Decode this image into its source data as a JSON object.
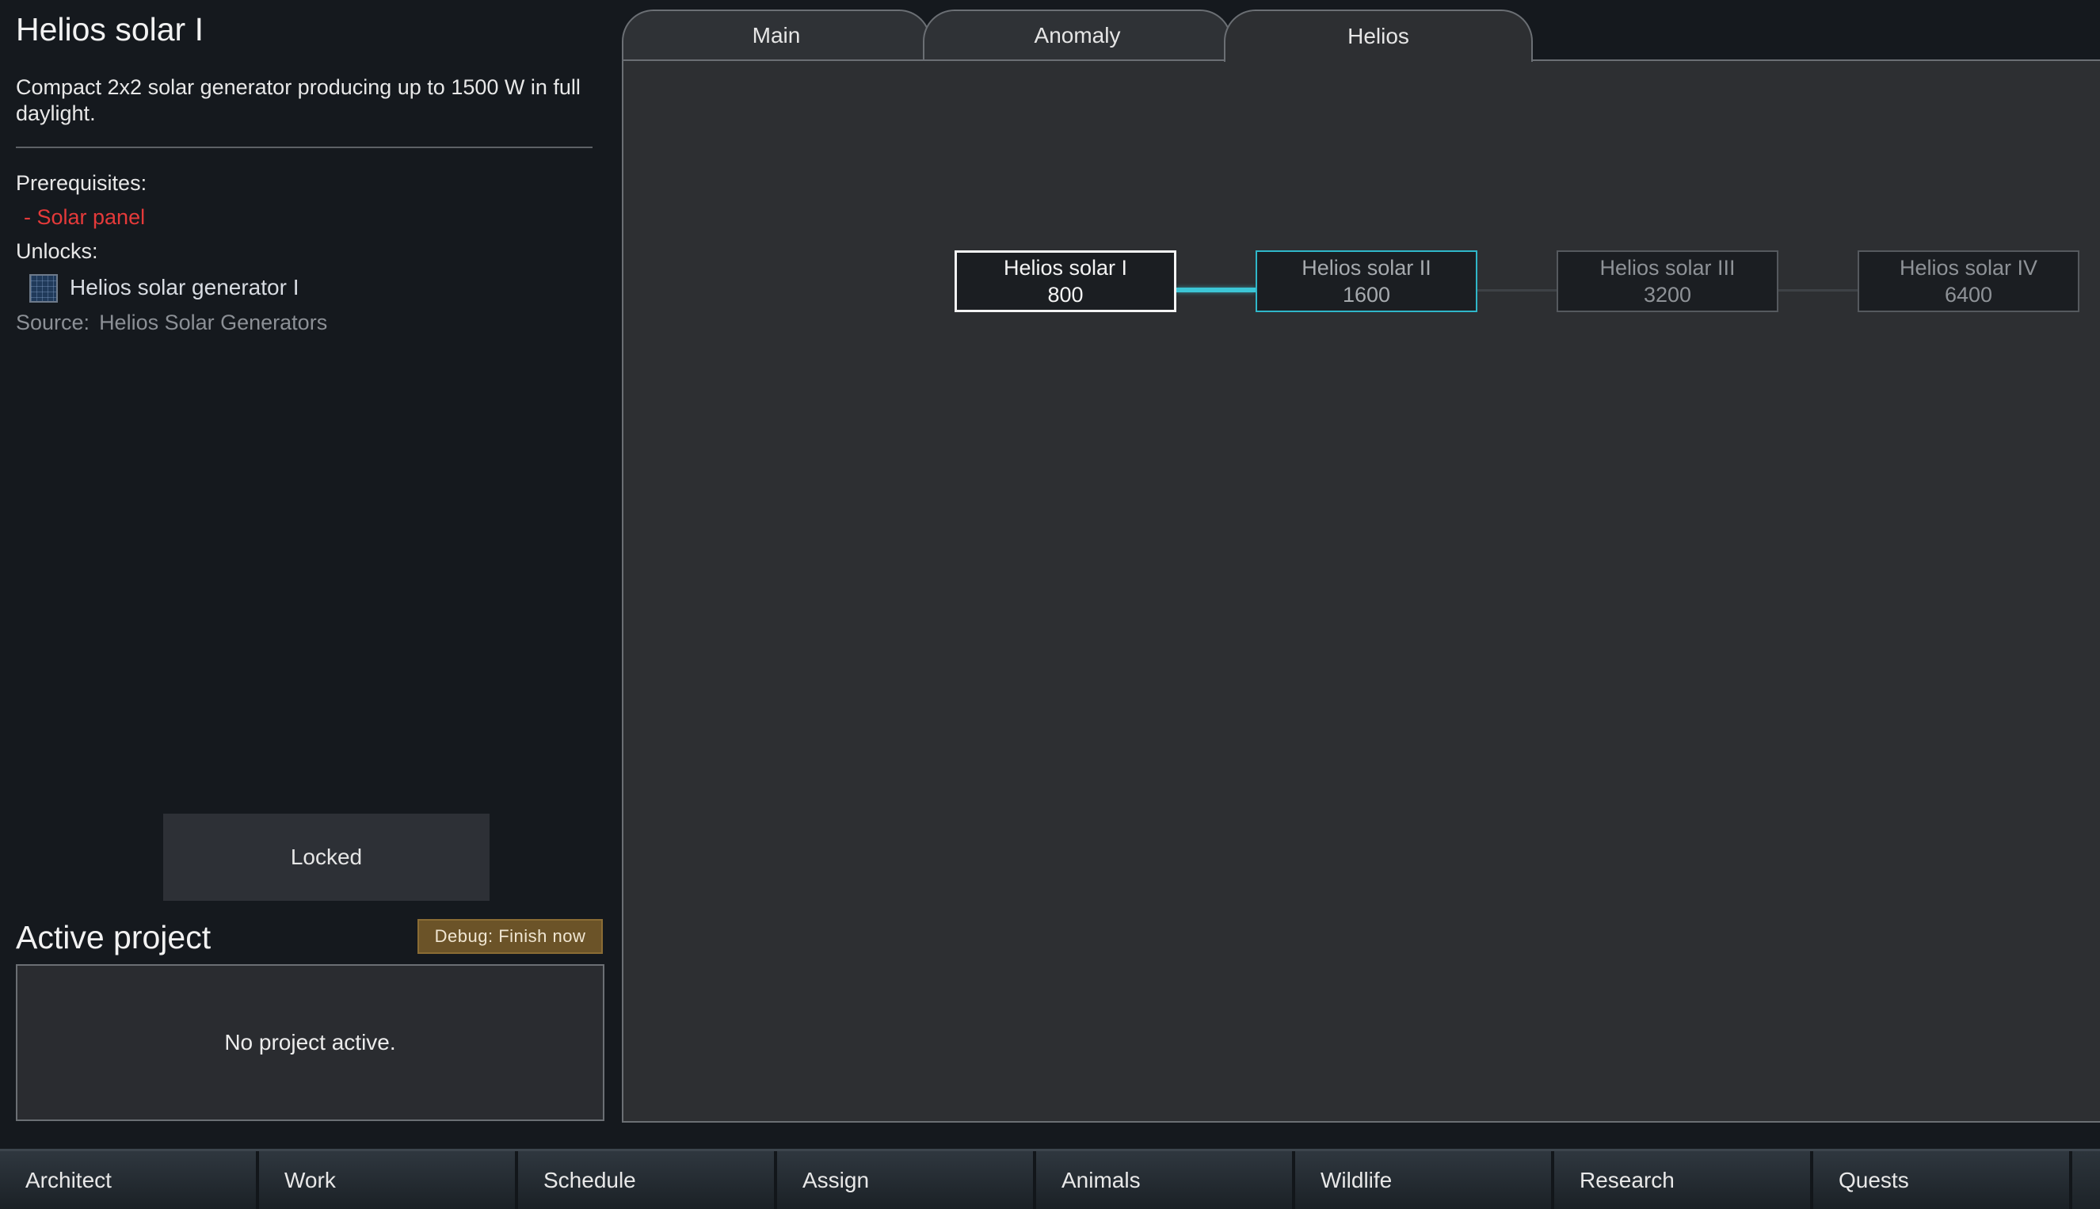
{
  "info": {
    "title": "Helios solar I",
    "description": "Compact 2x2 solar generator producing up to 1500 W in full daylight.",
    "prerequisites_label": "Prerequisites:",
    "prerequisites": [
      "- Solar panel"
    ],
    "unlocks_label": "Unlocks:",
    "unlocks": [
      {
        "label": "Helios solar generator I",
        "icon": "solar-generator-icon"
      }
    ],
    "source_label": "Source:",
    "source_value": "Helios Solar Generators",
    "status_button": "Locked"
  },
  "active_project": {
    "title": "Active project",
    "debug_button": "Debug: Finish now",
    "empty_text": "No project active."
  },
  "tabs": [
    {
      "label": "Main",
      "selected": false
    },
    {
      "label": "Anomaly",
      "selected": false
    },
    {
      "label": "Helios",
      "selected": true
    }
  ],
  "tree": {
    "nodes": [
      {
        "name": "Helios solar I",
        "cost": "800",
        "state": "selected"
      },
      {
        "name": "Helios solar II",
        "cost": "1600",
        "state": "available"
      },
      {
        "name": "Helios solar III",
        "cost": "3200",
        "state": "locked"
      },
      {
        "name": "Helios solar IV",
        "cost": "6400",
        "state": "locked"
      }
    ]
  },
  "bottom_bar": [
    "Architect",
    "Work",
    "Schedule",
    "Assign",
    "Animals",
    "Wildlife",
    "Research",
    "Quests"
  ],
  "colors": {
    "background": "#15191e",
    "panel": "#2d2f32",
    "prerequisite_missing": "#e53a3a",
    "connector_active": "#3cc6d6",
    "debug_button": "#6b5328"
  }
}
